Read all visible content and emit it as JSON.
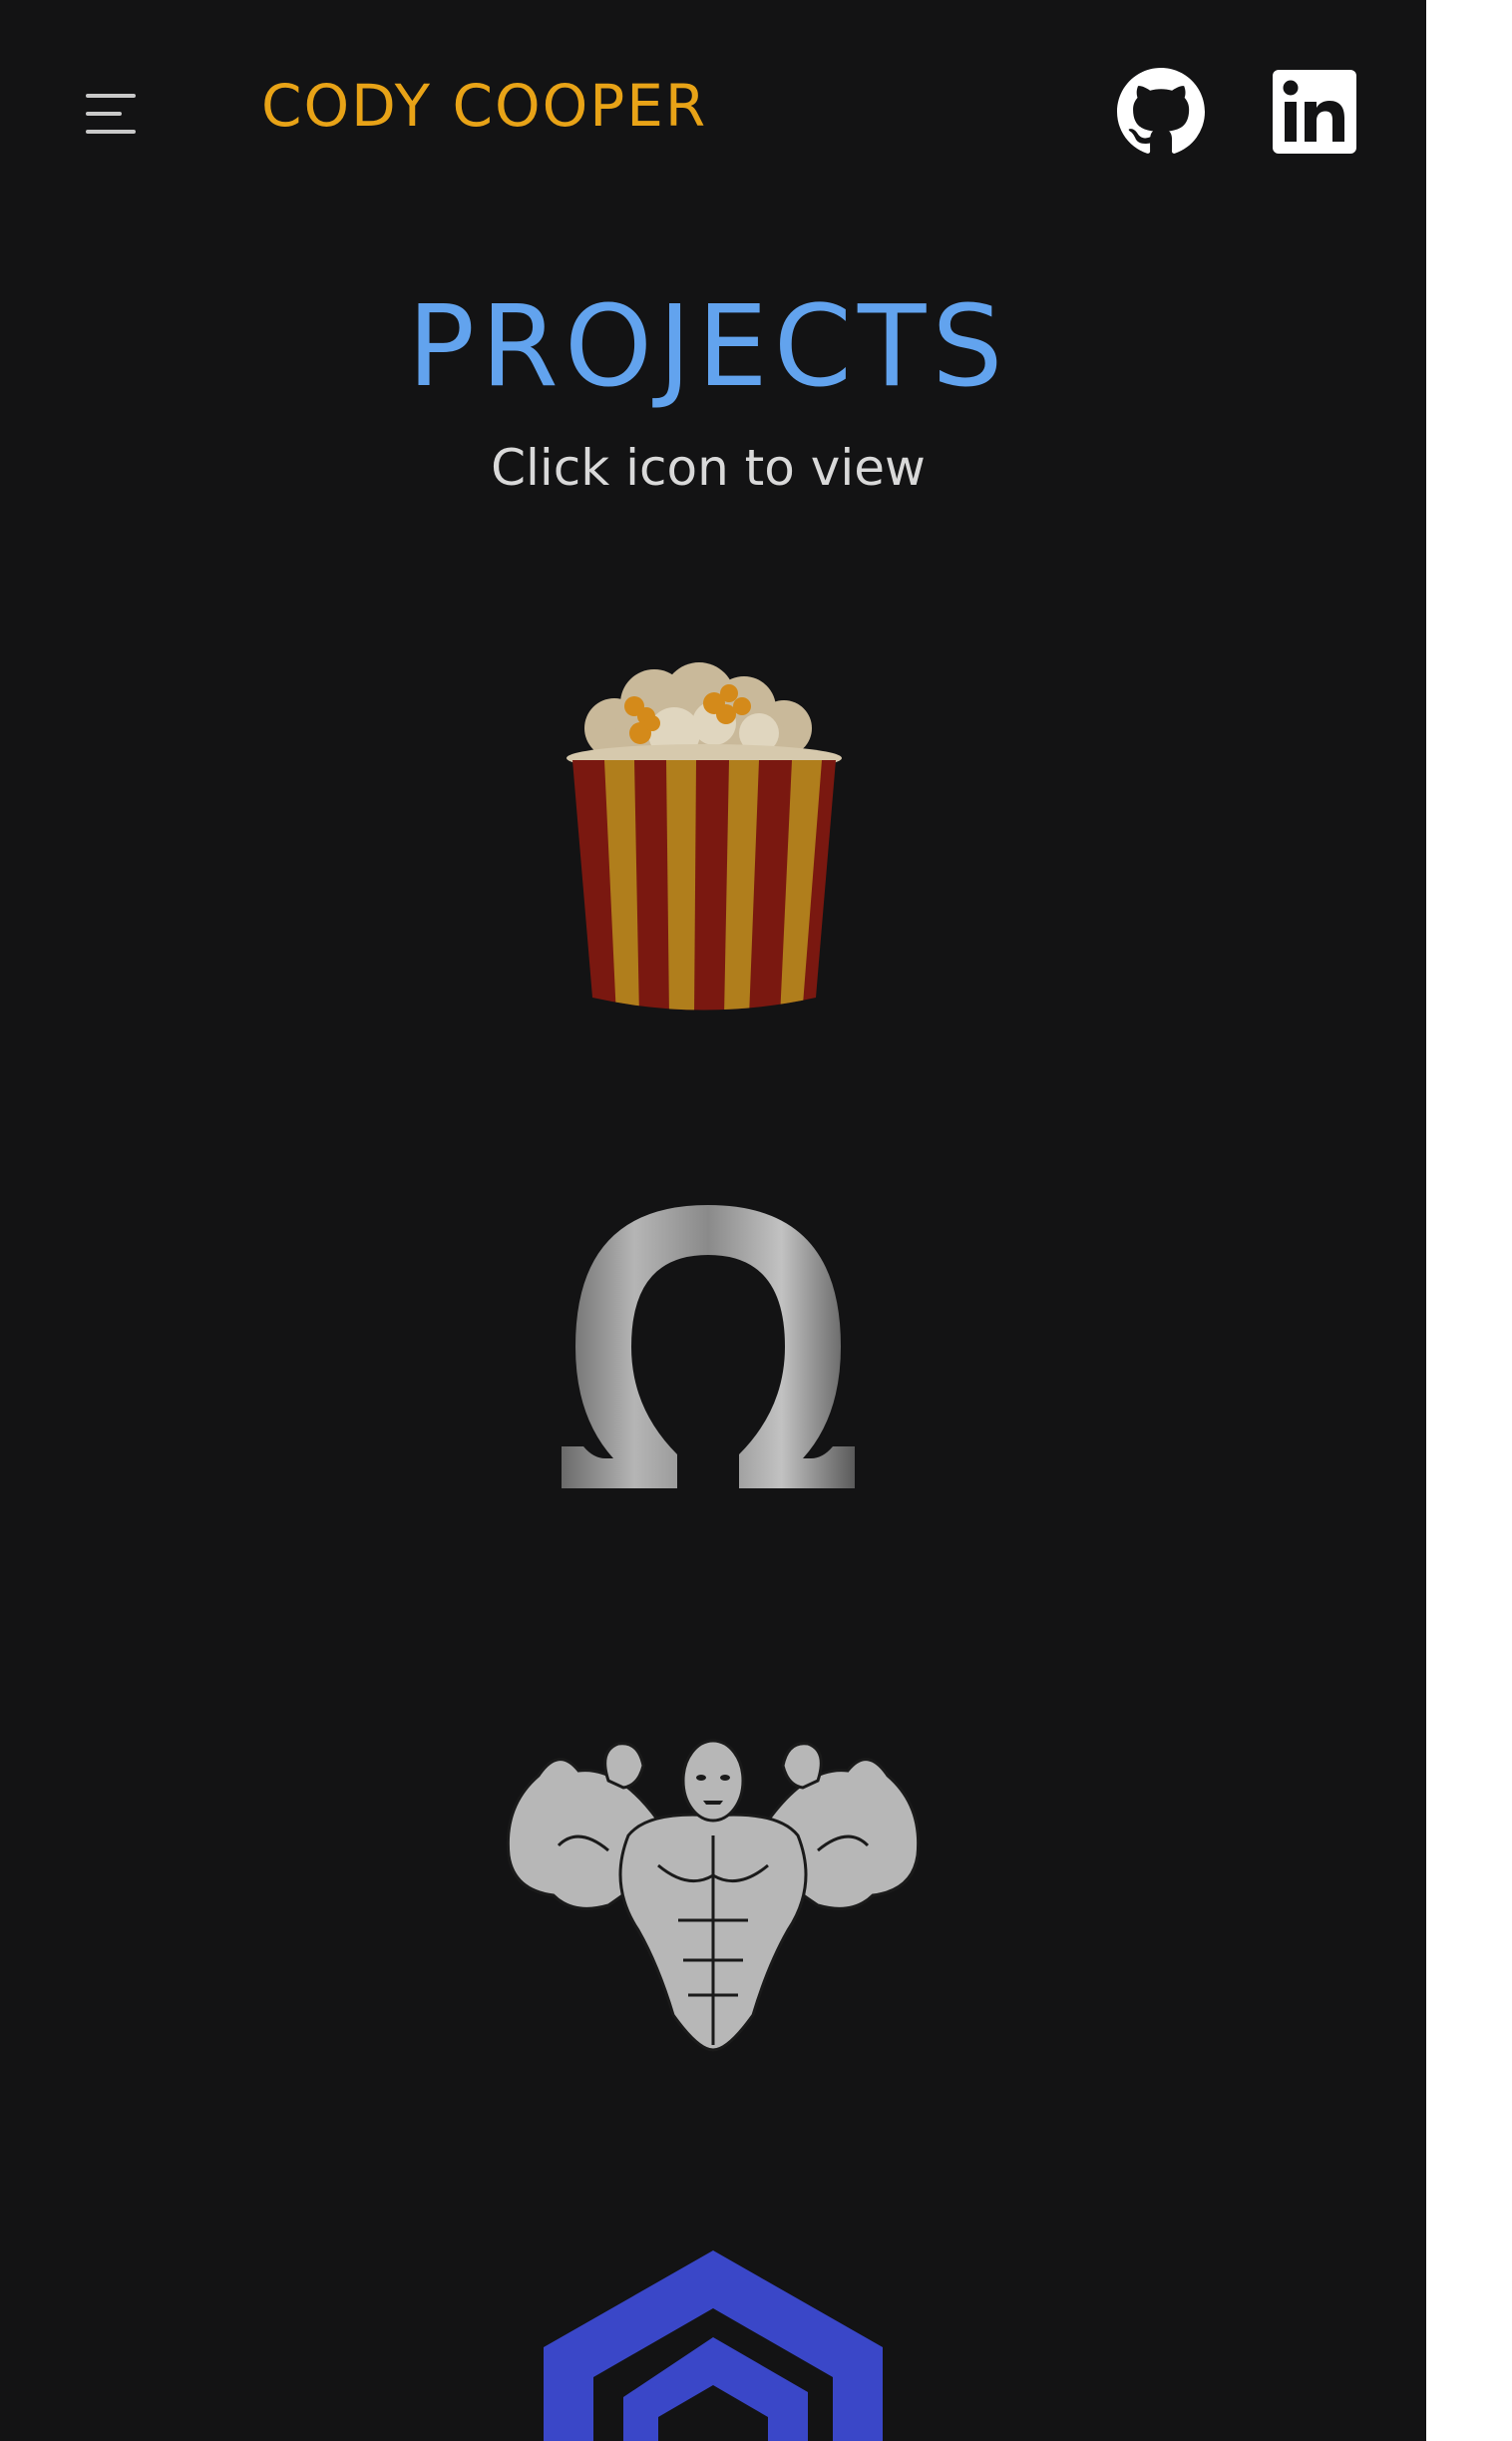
{
  "header": {
    "brand": "CODY COOPER",
    "menu_icon": "hamburger-menu-icon",
    "social": [
      {
        "icon": "github-icon"
      },
      {
        "icon": "linkedin-icon"
      }
    ]
  },
  "main": {
    "title": "PROJECTS",
    "subtitle": "Click icon to view",
    "projects": [
      {
        "icon": "popcorn-icon"
      },
      {
        "icon": "omega-icon"
      },
      {
        "icon": "bodybuilder-icon"
      },
      {
        "icon": "hexagon-cube-logo-icon"
      }
    ]
  },
  "colors": {
    "background": "#131314",
    "brand": "#e8a317",
    "title": "#62a3ee",
    "subtitle": "#d9d9d9",
    "icon_white": "#ffffff",
    "cube_blue": "#3a47c8"
  }
}
